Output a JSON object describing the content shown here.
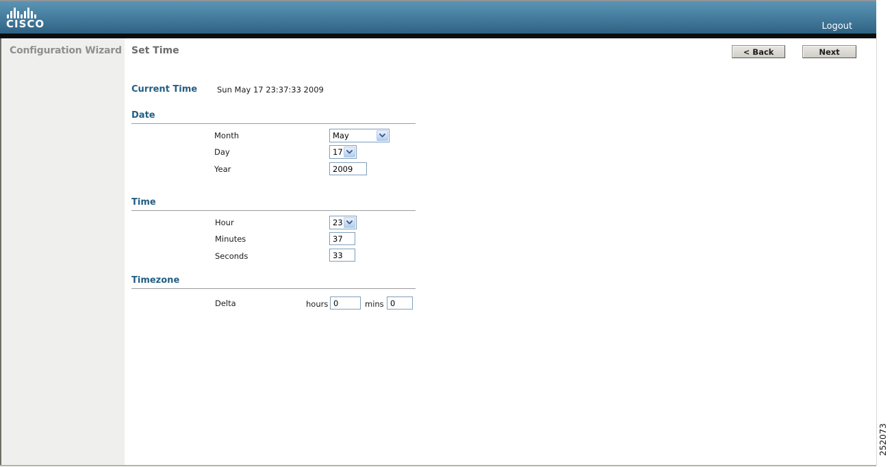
{
  "header": {
    "logo_text": "CISCO",
    "logout_label": "Logout"
  },
  "sidebar": {
    "title": "Configuration Wizard"
  },
  "page": {
    "title": "Set Time",
    "back_label": "< Back",
    "next_label": "Next",
    "figure_number": "252073"
  },
  "current_time": {
    "label": "Current Time",
    "value": "Sun May 17 23:37:33 2009"
  },
  "date_section": {
    "heading": "Date",
    "month_label": "Month",
    "month_value": "May",
    "day_label": "Day",
    "day_value": "17",
    "year_label": "Year",
    "year_value": "2009"
  },
  "time_section": {
    "heading": "Time",
    "hour_label": "Hour",
    "hour_value": "23",
    "minutes_label": "Minutes",
    "minutes_value": "37",
    "seconds_label": "Seconds",
    "seconds_value": "33"
  },
  "timezone_section": {
    "heading": "Timezone",
    "delta_label": "Delta",
    "hours_label": "hours",
    "hours_value": "0",
    "mins_label": "mins",
    "mins_value": "0"
  },
  "colors": {
    "header_gradient_top": "#5b93b2",
    "header_gradient_bottom": "#2f6282",
    "heading_blue": "#235e84",
    "sidebar_bg": "#efefed",
    "select_border": "#7f9db9"
  }
}
